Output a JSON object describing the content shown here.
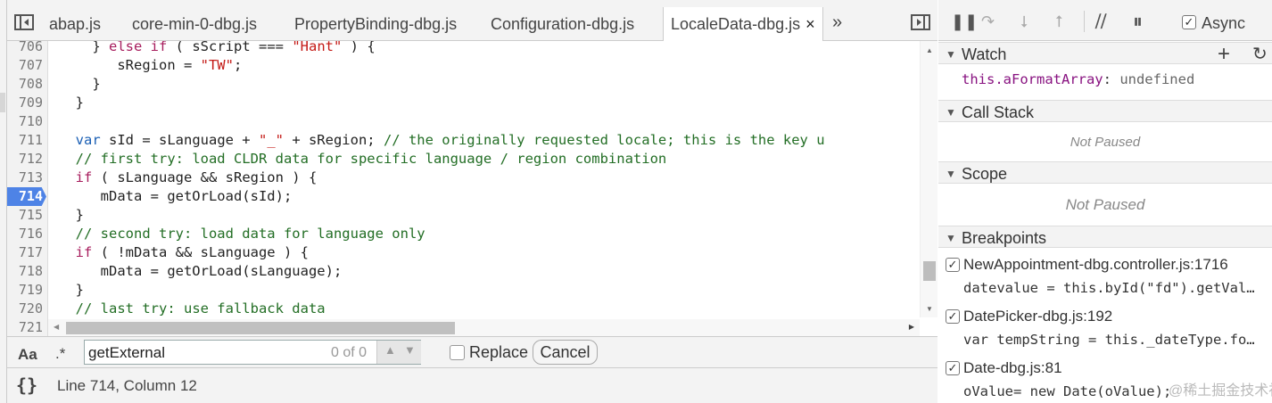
{
  "editor": {
    "tabs": [
      {
        "label": "abap.js"
      },
      {
        "label": "core-min-0-dbg.js"
      },
      {
        "label": "PropertyBinding-dbg.js"
      },
      {
        "label": "Configuration-dbg.js"
      },
      {
        "label": "LocaleData-dbg.js",
        "active": true
      }
    ],
    "more_label": "»",
    "close_glyph": "×",
    "lines": [
      {
        "n": "706",
        "text": "    } else if ( sScript === \"Hant\" ) {"
      },
      {
        "n": "707",
        "text": "       sRegion = \"TW\";"
      },
      {
        "n": "708",
        "text": "    }"
      },
      {
        "n": "709",
        "text": "  }"
      },
      {
        "n": "710",
        "text": ""
      },
      {
        "n": "711",
        "text": "  var sId = sLanguage + \"_\" + sRegion; // the originally requested locale; this is the key u"
      },
      {
        "n": "712",
        "text": "  // first try: load CLDR data for specific language / region combination"
      },
      {
        "n": "713",
        "text": "  if ( sLanguage && sRegion ) {"
      },
      {
        "n": "714",
        "text": "     mData = getOrLoad(sId);",
        "breakpoint": true
      },
      {
        "n": "715",
        "text": "  }"
      },
      {
        "n": "716",
        "text": "  // second try: load data for language only"
      },
      {
        "n": "717",
        "text": "  if ( !mData && sLanguage ) {"
      },
      {
        "n": "718",
        "text": "     mData = getOrLoad(sLanguage);"
      },
      {
        "n": "719",
        "text": "  }"
      },
      {
        "n": "720",
        "text": "  // last try: use fallback data"
      },
      {
        "n": "721",
        "text": ""
      }
    ]
  },
  "search": {
    "case_label": "Aa",
    "regex_label": ".*",
    "value": "getExternal",
    "count": "0 of 0",
    "replace_label": "Replace",
    "cancel_label": "Cancel"
  },
  "status": {
    "pretty_print_label": "{}",
    "cursor": "Line 714, Column 12"
  },
  "debugger": {
    "async_label": "Async",
    "async_checked": true,
    "watch": {
      "title": "Watch",
      "expression": "this.aFormatArray",
      "value": "undefined"
    },
    "call_stack": {
      "title": "Call Stack",
      "status": "Not Paused"
    },
    "scope": {
      "title": "Scope",
      "status": "Not Paused"
    },
    "breakpoints": {
      "title": "Breakpoints",
      "items": [
        {
          "location": "NewAppointment-dbg.controller.js:1716",
          "snippet": "datevalue = this.byId(\"fd\").getVal…"
        },
        {
          "location": "DatePicker-dbg.js:192",
          "snippet": "var tempString = this._dateType.fo…"
        },
        {
          "location": "Date-dbg.js:81",
          "snippet": "oValue= new Date(oValue);"
        }
      ]
    }
  },
  "watermark": "@稀土掘金技术社区",
  "colors": {
    "breakpoint_marker": "#4e83e6",
    "keyword": "#a71d5d",
    "string": "#c41a16",
    "comment": "#236e25",
    "watch_key": "#881280"
  }
}
